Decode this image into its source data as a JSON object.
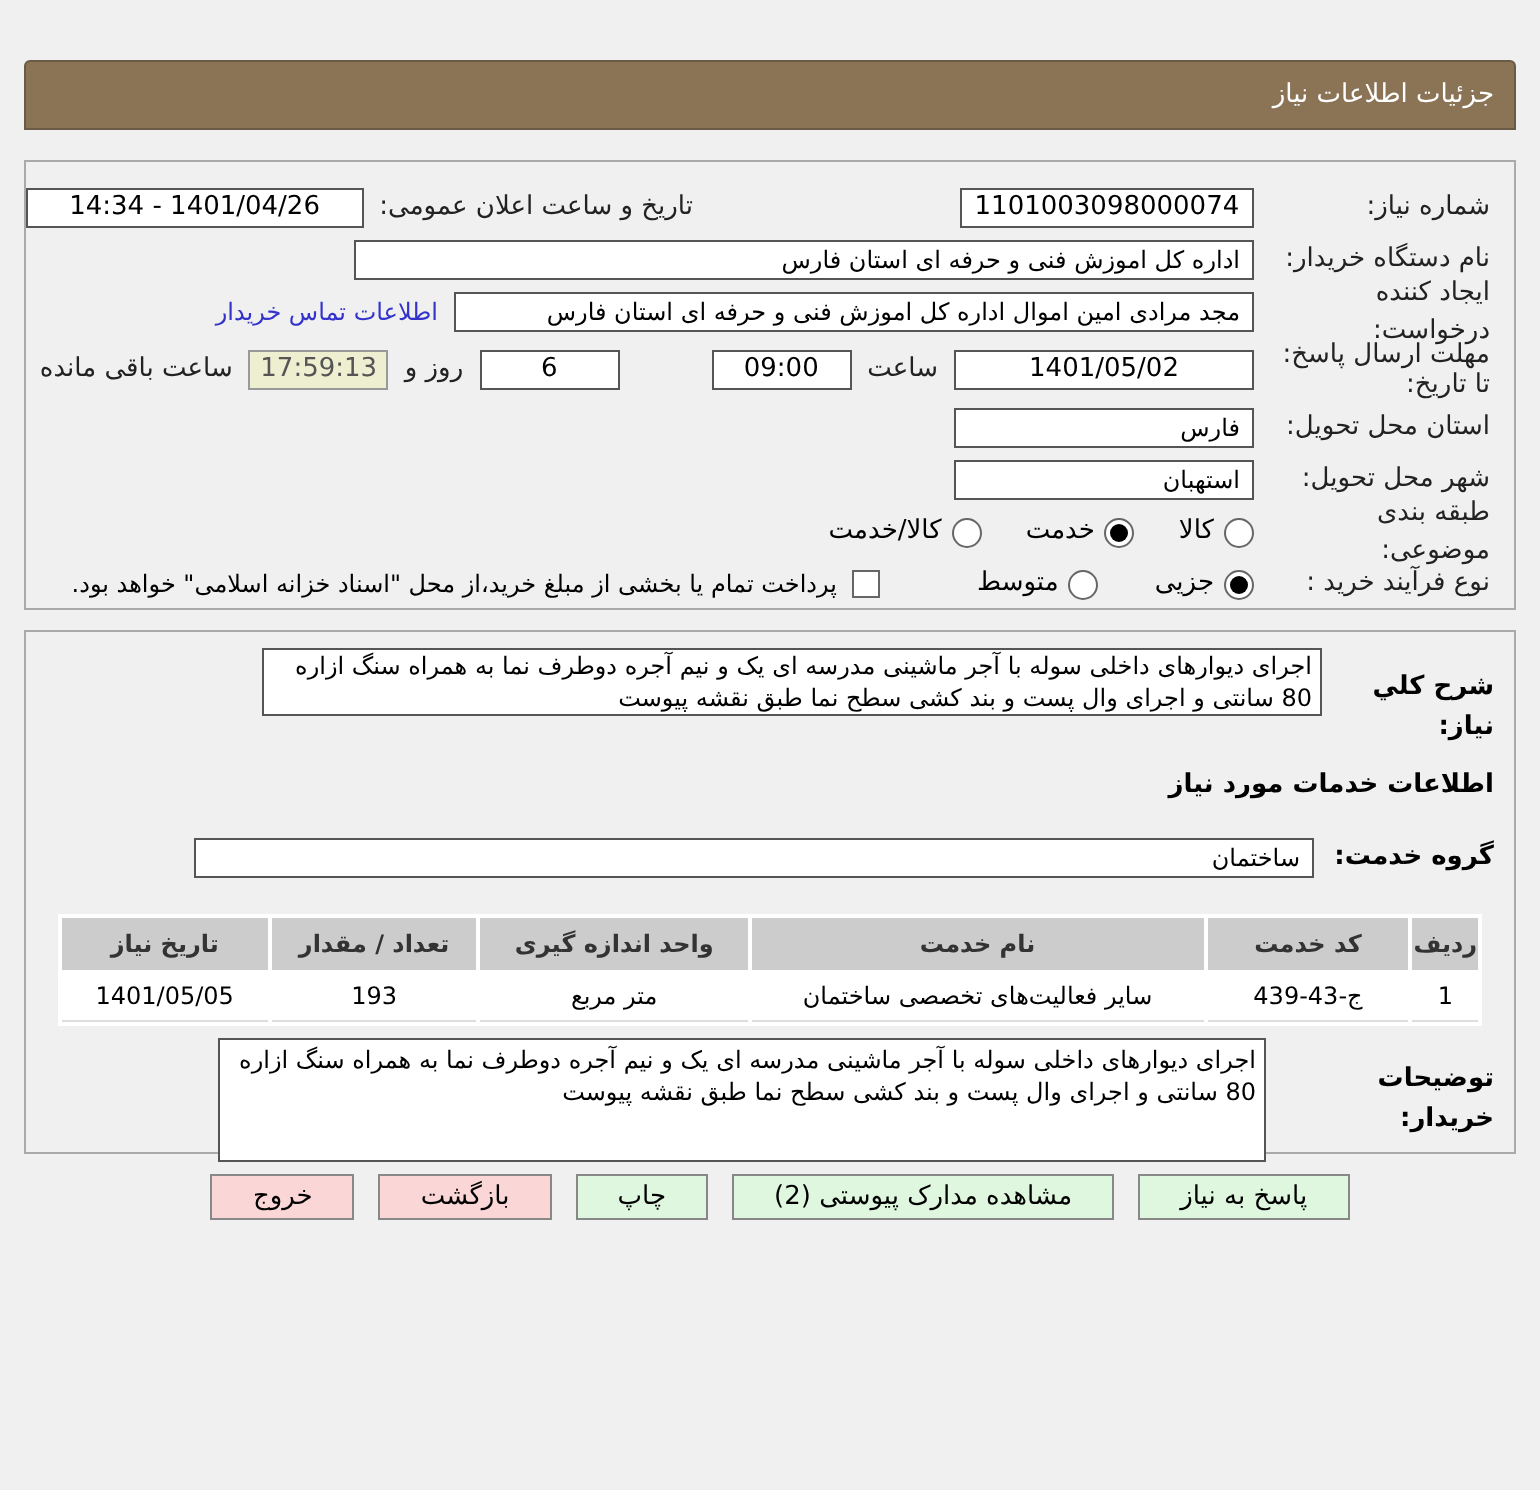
{
  "header": {
    "title": "جزئیات اطلاعات نیاز"
  },
  "details": {
    "need_number": {
      "label": "شماره نیاز:",
      "value": "1101003098000074"
    },
    "announce": {
      "label": "تاریخ و ساعت اعلان عمومی:",
      "value": "1401/04/26 - 14:34"
    },
    "buyer_org": {
      "label": "نام دستگاه خریدار:",
      "value": "اداره کل اموزش فنی و حرفه ای استان فارس"
    },
    "requester": {
      "label": "ایجاد کننده درخواست:",
      "value": "مجد مرادی امین  اموال اداره کل اموزش فنی و حرفه ای استان فارس",
      "link": "اطلاعات تماس خریدار"
    },
    "deadline": {
      "label": "مهلت ارسال پاسخ: تا تاریخ:",
      "date": "1401/05/02",
      "time_label": "ساعت",
      "time": "09:00",
      "days": "6",
      "days_label": "روز و",
      "remaining": "17:59:13",
      "remaining_label": "ساعت باقی مانده"
    },
    "province": {
      "label": "استان محل تحویل:",
      "value": "فارس"
    },
    "city": {
      "label": "شهر محل تحویل:",
      "value": "استهبان"
    },
    "category": {
      "label": "طبقه بندی موضوعی:",
      "options": [
        {
          "label": "کالا",
          "selected": false
        },
        {
          "label": "خدمت",
          "selected": true
        },
        {
          "label": "کالا/خدمت",
          "selected": false
        }
      ]
    },
    "process": {
      "label": "نوع فرآیند خرید :",
      "options": [
        {
          "label": "جزیی",
          "selected": true
        },
        {
          "label": "متوسط",
          "selected": false
        }
      ],
      "checkbox": {
        "label": "پرداخت تمام یا بخشی از مبلغ خرید،از محل \"اسناد خزانه اسلامی\" خواهد بود.",
        "checked": false
      }
    }
  },
  "summary": {
    "label": "شرح کلي نياز:",
    "value": "اجرای دیوارهای داخلی سوله با آجر ماشینی مدرسه ای یک و نیم آجره دوطرف نما به همراه سنگ ازاره 80 سانتی و اجرای وال پست و بند کشی سطح نما طبق نقشه پیوست"
  },
  "services_title": "اطلاعات خدمات مورد نیاز",
  "service_group": {
    "label": "گروه خدمت:",
    "value": "ساختمان"
  },
  "table": {
    "columns": [
      "ردیف",
      "کد خدمت",
      "نام خدمت",
      "واحد اندازه گیری",
      "تعداد / مقدار",
      "تاریخ نیاز"
    ],
    "rows": [
      [
        "1",
        "ج-43-439",
        "سایر فعالیت‌های تخصصی ساختمان",
        "متر مربع",
        "193",
        "1401/05/05"
      ]
    ]
  },
  "buyer_notes": {
    "label": "توضیحات خریدار:",
    "value": "اجرای دیوارهای داخلی  سوله با آجر ماشینی مدرسه ای یک و نیم آجره دوطرف نما به همراه سنگ ازاره 80 سانتی و اجرای وال پست و بند کشی سطح نما طبق نقشه پیوست"
  },
  "buttons": [
    {
      "label": "پاسخ به نیاز",
      "kind": "normal"
    },
    {
      "label": "مشاهده مدارک پیوستی (2)",
      "kind": "normal"
    },
    {
      "label": "چاپ",
      "kind": "normal"
    },
    {
      "label": "بازگشت",
      "kind": "danger"
    },
    {
      "label": "خروج",
      "kind": "danger"
    }
  ]
}
